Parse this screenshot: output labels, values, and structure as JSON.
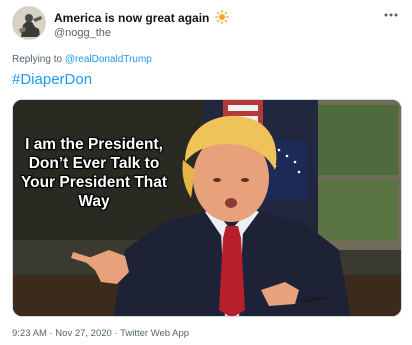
{
  "tweet": {
    "display_name": "America is now great again",
    "handle": "@nogg_the",
    "reply_prefix": "Replying to",
    "reply_to": "@realDonaldTrump",
    "hashtag": "#DiaperDon",
    "media_caption": "I am the President, Don’t Ever Talk to Your President That Way",
    "timestamp": "9:23 AM · Nov 27, 2020 · Twitter Web App"
  },
  "icons": {
    "display_name_emoji": "sun-icon",
    "more": "more-icon",
    "avatar": "avatar"
  },
  "colors": {
    "link": "#1d9bf0",
    "secondary_text": "#536471",
    "sun": "#f5a623"
  }
}
